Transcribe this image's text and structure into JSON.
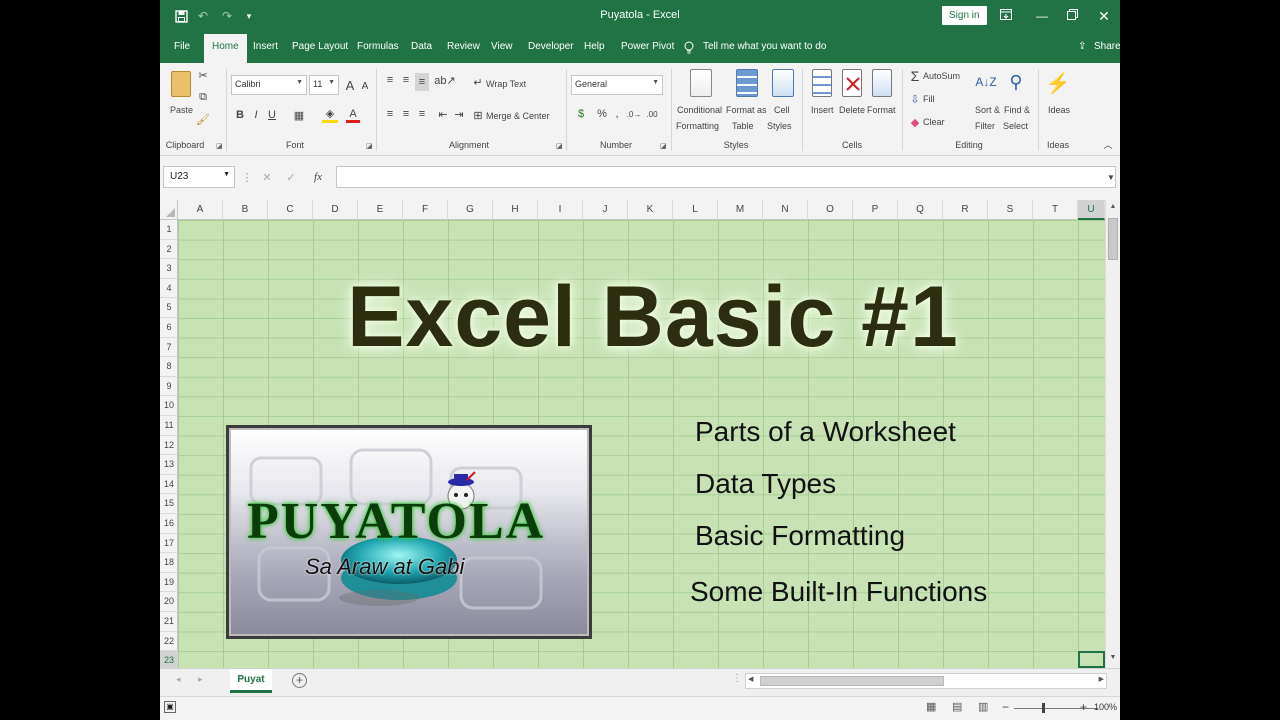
{
  "titlebar": {
    "doc_title": "Puyatola  -  Excel",
    "signin_label": "Sign in"
  },
  "tabs": [
    {
      "label": "File"
    },
    {
      "label": "Home"
    },
    {
      "label": "Insert"
    },
    {
      "label": "Page Layout"
    },
    {
      "label": "Formulas"
    },
    {
      "label": "Data"
    },
    {
      "label": "Review"
    },
    {
      "label": "View"
    },
    {
      "label": "Developer"
    },
    {
      "label": "Help"
    },
    {
      "label": "Power Pivot"
    }
  ],
  "tell_me": "Tell me what you want to do",
  "share_label": "Share",
  "ribbon": {
    "clipboard": {
      "paste": "Paste",
      "group": "Clipboard"
    },
    "font": {
      "name": "Calibri",
      "size": "11",
      "bold": "B",
      "italic": "I",
      "underline": "U",
      "color_a": "A",
      "group": "Font"
    },
    "alignment": {
      "wrap": "Wrap Text",
      "merge": "Merge & Center",
      "group": "Alignment"
    },
    "number": {
      "format": "General",
      "group": "Number"
    },
    "styles": {
      "conditional_1": "Conditional",
      "conditional_2": "Formatting",
      "format_table_1": "Format as",
      "format_table_2": "Table",
      "cell_styles_1": "Cell",
      "cell_styles_2": "Styles",
      "group": "Styles"
    },
    "cells": {
      "insert": "Insert",
      "delete": "Delete",
      "format": "Format",
      "group": "Cells"
    },
    "editing": {
      "autosum": "AutoSum",
      "fill": "Fill",
      "clear": "Clear",
      "sort_1": "Sort &",
      "sort_2": "Filter",
      "find_1": "Find &",
      "find_2": "Select",
      "group": "Editing"
    },
    "ideas": {
      "label": "Ideas",
      "group": "Ideas"
    }
  },
  "formula_bar": {
    "name_box": "U23",
    "fx": "fx",
    "value": ""
  },
  "columns": [
    "A",
    "B",
    "C",
    "D",
    "E",
    "F",
    "G",
    "H",
    "I",
    "J",
    "K",
    "L",
    "M",
    "N",
    "O",
    "P",
    "Q",
    "R",
    "S",
    "T",
    "U"
  ],
  "rows": [
    "1",
    "2",
    "3",
    "4",
    "5",
    "6",
    "7",
    "8",
    "9",
    "10",
    "11",
    "12",
    "13",
    "14",
    "15",
    "16",
    "17",
    "18",
    "19",
    "20",
    "21",
    "22",
    "23"
  ],
  "sheet": {
    "title": "Excel Basic #1",
    "logo_text": "PUYATOLA",
    "logo_subtitle": "Sa Araw at Gabi",
    "bullets": [
      "Parts of a Worksheet",
      "Data Types",
      "Basic Formatting",
      "Some Built-In Functions"
    ]
  },
  "sheet_tabs": {
    "active": "Puyat"
  },
  "status": {
    "zoom": "100%"
  },
  "colors": {
    "excel_green": "#217346",
    "cell_fill": "#c8e2b4",
    "title_text": "#2d2d10"
  }
}
